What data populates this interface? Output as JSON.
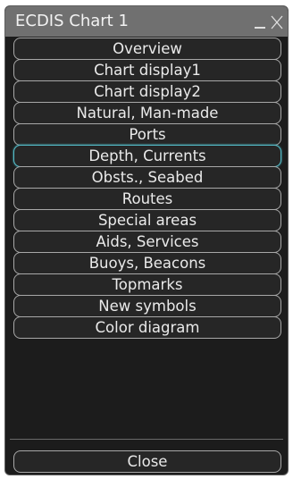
{
  "window": {
    "title": "ECDIS Chart 1",
    "minimize_icon": "minimize-icon",
    "close_icon": "close-icon"
  },
  "menu": {
    "items": [
      {
        "label": "Overview",
        "selected": false
      },
      {
        "label": "Chart display1",
        "selected": false
      },
      {
        "label": "Chart display2",
        "selected": false
      },
      {
        "label": "Natural, Man-made",
        "selected": false
      },
      {
        "label": "Ports",
        "selected": false
      },
      {
        "label": "Depth, Currents",
        "selected": true
      },
      {
        "label": "Obsts., Seabed",
        "selected": false
      },
      {
        "label": "Routes",
        "selected": false
      },
      {
        "label": "Special areas",
        "selected": false
      },
      {
        "label": "Aids, Services",
        "selected": false
      },
      {
        "label": "Buoys, Beacons",
        "selected": false
      },
      {
        "label": "Topmarks",
        "selected": false
      },
      {
        "label": "New symbols",
        "selected": false
      },
      {
        "label": "Color diagram",
        "selected": false
      }
    ],
    "close_label": "Close"
  },
  "colors": {
    "window_bg": "#1c1c1c",
    "titlebar_bg": "#707070",
    "button_bg": "#262626",
    "button_border": "#a8a8a8",
    "selected_border": "#54bcc8",
    "text": "#eaeaea"
  }
}
